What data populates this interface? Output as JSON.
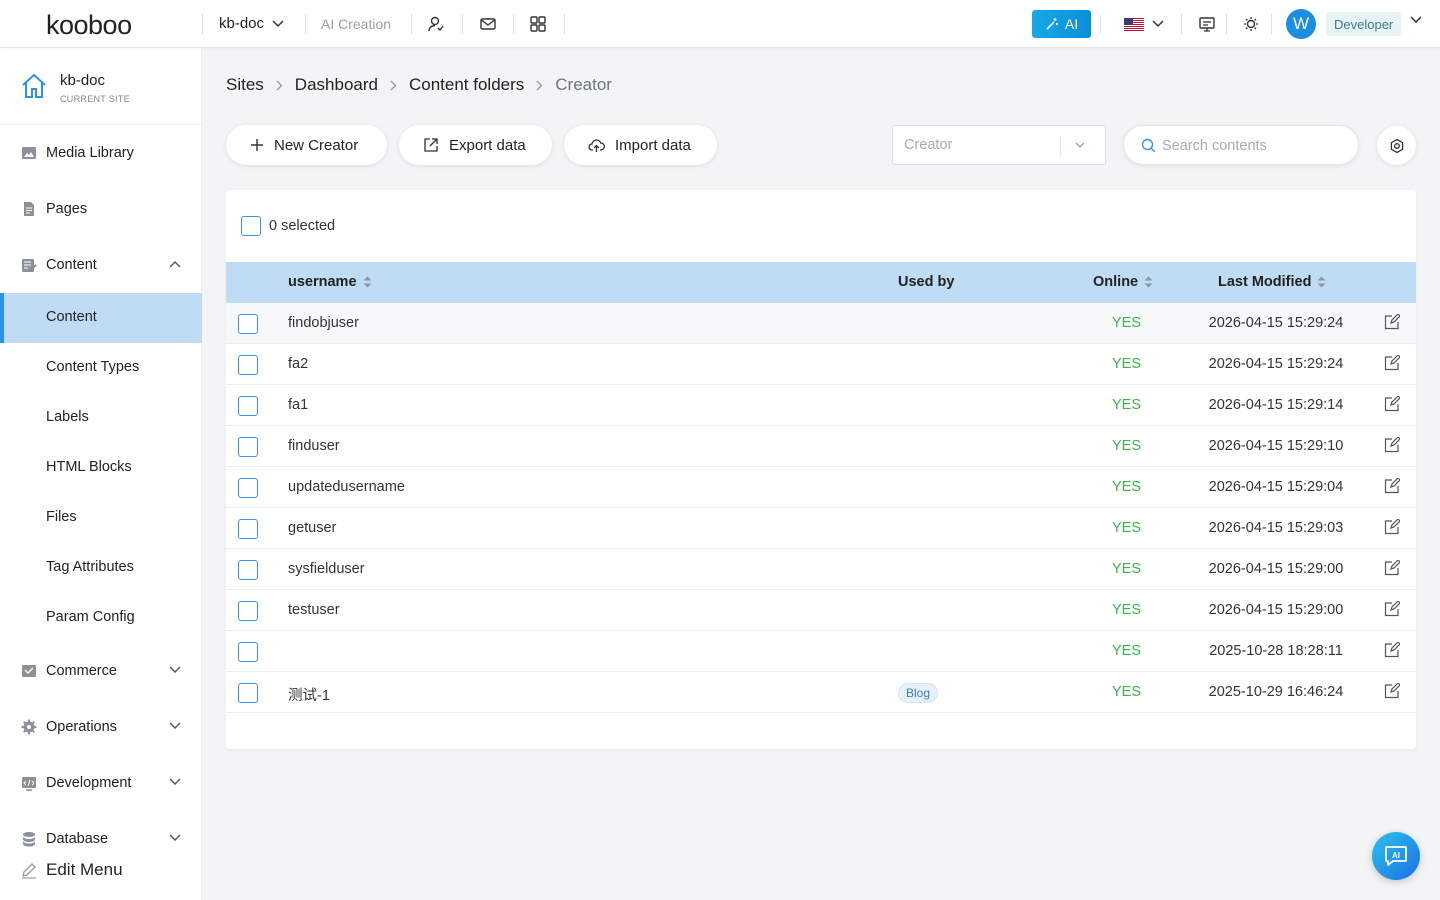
{
  "topbar": {
    "logo": "kooboo",
    "site": "kb-doc",
    "ai_creation": "AI Creation",
    "ai_button": "AI",
    "avatar_letter": "W",
    "role": "Developer"
  },
  "sidebar": {
    "site_name": "kb-doc",
    "site_sub": "CURRENT SITE",
    "items": [
      {
        "label": "Media Library",
        "icon": "image-icon"
      },
      {
        "label": "Pages",
        "icon": "document-icon"
      },
      {
        "label": "Content",
        "icon": "content-icon",
        "expanded": true
      },
      {
        "label": "Commerce",
        "icon": "commerce-icon"
      },
      {
        "label": "Operations",
        "icon": "gear-icon"
      },
      {
        "label": "Development",
        "icon": "code-icon"
      },
      {
        "label": "Database",
        "icon": "database-icon"
      }
    ],
    "content_sub": [
      "Content",
      "Content Types",
      "Labels",
      "HTML Blocks",
      "Files",
      "Tag Attributes",
      "Param Config"
    ],
    "active_sub": "Content",
    "edit_menu": "Edit Menu"
  },
  "breadcrumb": [
    "Sites",
    "Dashboard",
    "Content folders",
    "Creator"
  ],
  "toolbar": {
    "new_label": "New Creator",
    "export_label": "Export data",
    "import_label": "Import data",
    "select_placeholder": "Creator",
    "search_placeholder": "Search contents"
  },
  "table": {
    "selected_label": "0 selected",
    "columns": {
      "username": "username",
      "used_by": "Used by",
      "online": "Online",
      "last_modified": "Last Modified"
    },
    "rows": [
      {
        "username": "findobjuser",
        "used_by": "",
        "online": "YES",
        "last_modified": "2026-04-15 15:29:24"
      },
      {
        "username": "fa2",
        "used_by": "",
        "online": "YES",
        "last_modified": "2026-04-15 15:29:24"
      },
      {
        "username": "fa1",
        "used_by": "",
        "online": "YES",
        "last_modified": "2026-04-15 15:29:14"
      },
      {
        "username": "finduser",
        "used_by": "",
        "online": "YES",
        "last_modified": "2026-04-15 15:29:10"
      },
      {
        "username": "updatedusername",
        "used_by": "",
        "online": "YES",
        "last_modified": "2026-04-15 15:29:04"
      },
      {
        "username": "getuser",
        "used_by": "",
        "online": "YES",
        "last_modified": "2026-04-15 15:29:03"
      },
      {
        "username": "sysfielduser",
        "used_by": "",
        "online": "YES",
        "last_modified": "2026-04-15 15:29:00"
      },
      {
        "username": "testuser",
        "used_by": "",
        "online": "YES",
        "last_modified": "2026-04-15 15:29:00"
      },
      {
        "username": "",
        "used_by": "",
        "online": "YES",
        "last_modified": "2025-10-28 18:28:11"
      },
      {
        "username": "测试-1",
        "used_by": "Blog",
        "online": "YES",
        "last_modified": "2025-10-29 16:46:24"
      }
    ]
  },
  "colors": {
    "accent": "#2e93e6",
    "header_bg": "#bfdcf4",
    "online": "#39b54a"
  }
}
